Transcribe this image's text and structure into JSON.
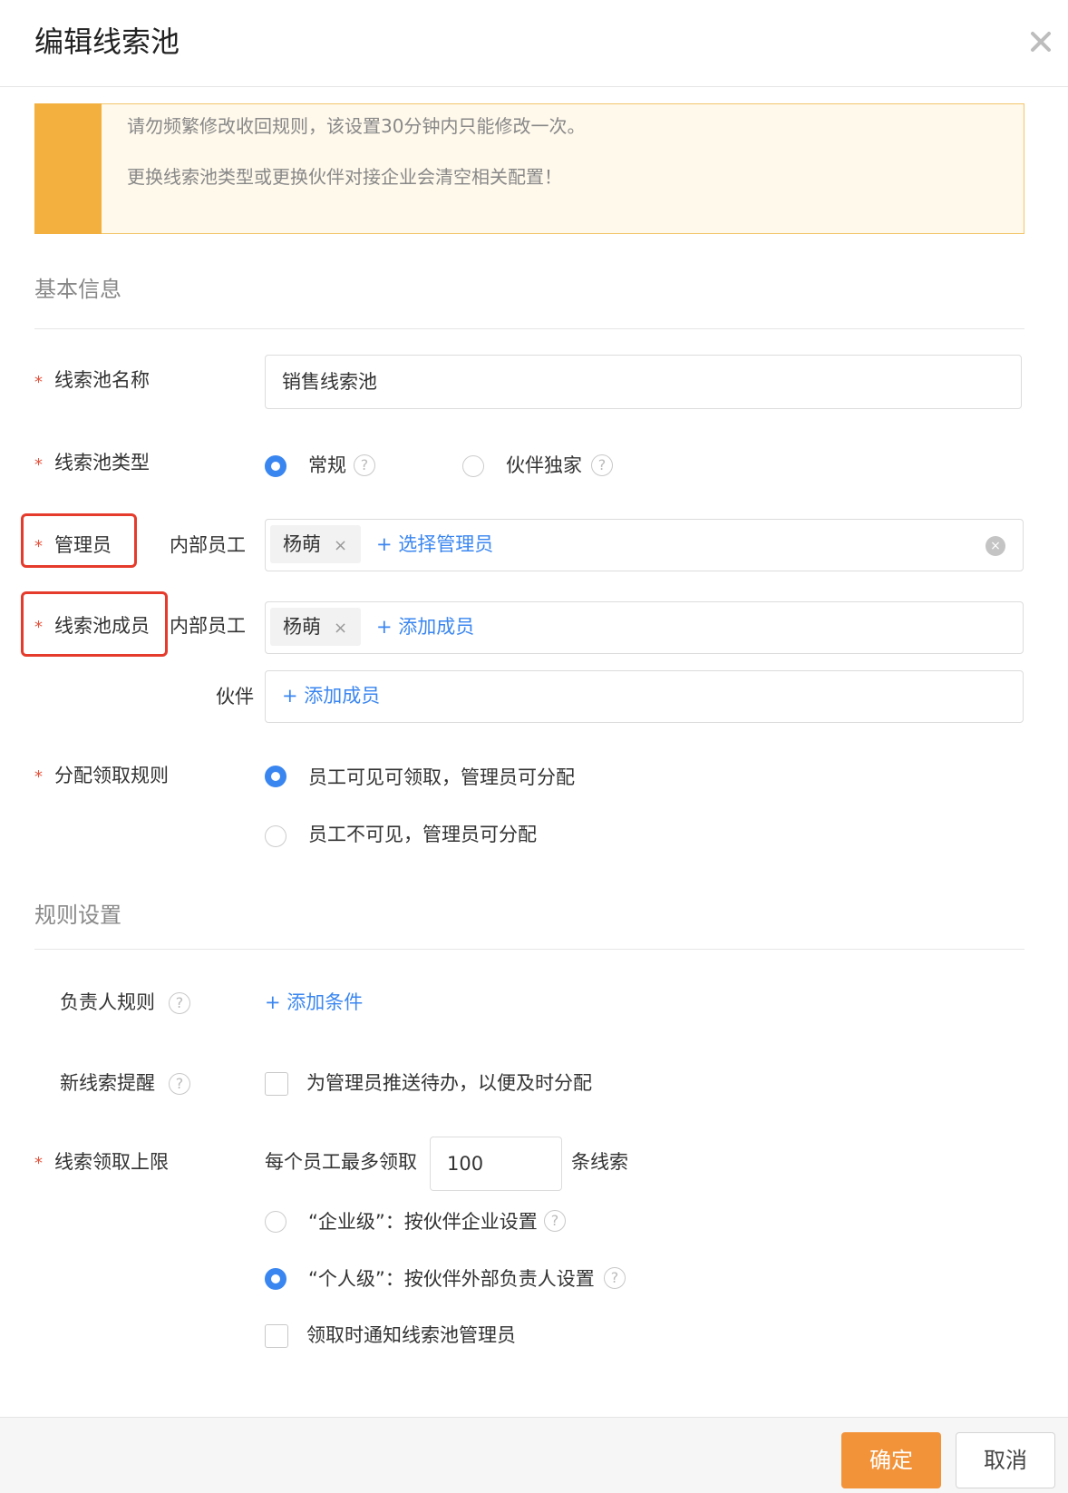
{
  "dialog": {
    "title": "编辑线索池"
  },
  "notice": {
    "line1": "请勿频繁修改收回规则，该设置30分钟内只能修改一次。",
    "line2": "更换线索池类型或更换伙伴对接企业会清空相关配置！"
  },
  "basic": {
    "section_title": "基本信息",
    "required_mark": "*",
    "pool_name": {
      "label": "线索池名称",
      "value": "销售线索池"
    },
    "pool_type": {
      "label": "线索池类型",
      "options": [
        {
          "label": "常规",
          "selected": true
        },
        {
          "label": "伙伴独家",
          "selected": false
        }
      ]
    },
    "admin": {
      "label": "管理员",
      "sublabel": "内部员工",
      "tag": "杨萌",
      "tag_remove": "×",
      "add_link": "+ 选择管理员",
      "clear": "×"
    },
    "members": {
      "label": "线索池成员",
      "internal_sublabel": "内部员工",
      "tag": "杨萌",
      "tag_remove": "×",
      "add_link": "+ 添加成员",
      "partner_sublabel": "伙伴",
      "partner_add_link": "+ 添加成员"
    },
    "distribution": {
      "label": "分配领取规则",
      "options": [
        {
          "label": "员工可见可领取，管理员可分配",
          "selected": true
        },
        {
          "label": "员工不可见，管理员可分配",
          "selected": false
        }
      ]
    }
  },
  "rules": {
    "section_title": "规则设置",
    "owner_rule": {
      "label": "负责人规则",
      "add_link": "+ 添加条件"
    },
    "new_lead_reminder": {
      "label": "新线索提醒",
      "checkbox_label": "为管理员推送待办，以便及时分配",
      "checked": false
    },
    "limit": {
      "label": "线索领取上限",
      "prefix": "每个员工最多领取",
      "value": "100",
      "suffix": "条线索",
      "options": [
        {
          "label": "“企业级”：按伙伴企业设置",
          "selected": false
        },
        {
          "label": "“个人级”：按伙伴外部负责人设置",
          "selected": true
        }
      ],
      "notify_label": "领取时通知线索池管理员",
      "notify_checked": false
    }
  },
  "help_glyph": "?",
  "footer": {
    "confirm": "确定",
    "cancel": "取消"
  },
  "colors": {
    "accent": "#f39339",
    "link": "#3a86f0",
    "required": "#e5533d",
    "highlight": "#e53b2c"
  }
}
